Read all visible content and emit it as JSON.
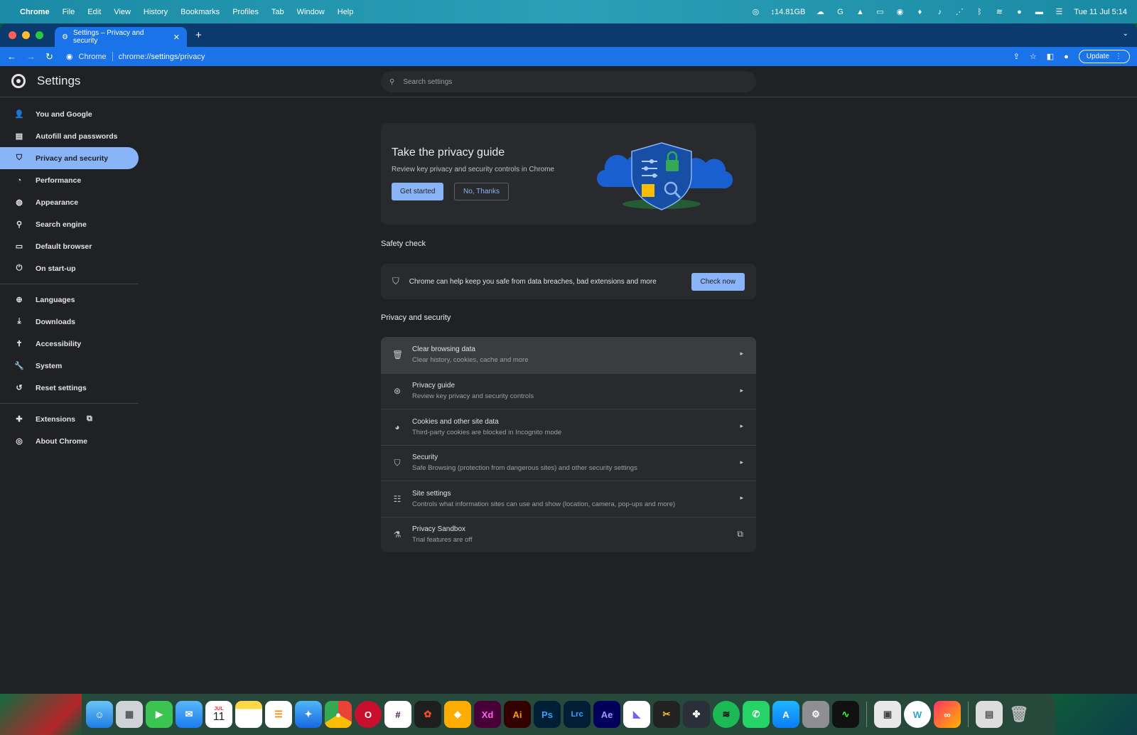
{
  "menubar": {
    "app": "Chrome",
    "items": [
      "File",
      "Edit",
      "View",
      "History",
      "Bookmarks",
      "Profiles",
      "Tab",
      "Window",
      "Help"
    ],
    "memory": "14.81GB",
    "datetime": "Tue 11 Jul  5:14"
  },
  "browser": {
    "tab_title": "Settings – Privacy and security",
    "omnibox_site": "Chrome",
    "url_prefix": "chrome://",
    "url_bold": "settings",
    "url_suffix": "/privacy",
    "update_label": "Update"
  },
  "settings": {
    "title": "Settings",
    "search_placeholder": "Search settings"
  },
  "sidebar": {
    "group1": [
      {
        "label": "You and Google",
        "icon": "person-icon"
      },
      {
        "label": "Autofill and passwords",
        "icon": "clipboard-icon"
      },
      {
        "label": "Privacy and security",
        "icon": "shield-icon",
        "active": true
      },
      {
        "label": "Performance",
        "icon": "speedometer-icon"
      },
      {
        "label": "Appearance",
        "icon": "palette-icon"
      },
      {
        "label": "Search engine",
        "icon": "search-icon"
      },
      {
        "label": "Default browser",
        "icon": "browser-icon"
      },
      {
        "label": "On start-up",
        "icon": "power-icon"
      }
    ],
    "group2": [
      {
        "label": "Languages",
        "icon": "globe-icon"
      },
      {
        "label": "Downloads",
        "icon": "download-icon"
      },
      {
        "label": "Accessibility",
        "icon": "accessibility-icon"
      },
      {
        "label": "System",
        "icon": "wrench-icon"
      },
      {
        "label": "Reset settings",
        "icon": "history-icon"
      }
    ],
    "group3": [
      {
        "label": "Extensions",
        "icon": "puzzle-icon"
      },
      {
        "label": "About Chrome",
        "icon": "chrome-icon"
      }
    ]
  },
  "guide": {
    "title": "Take the privacy guide",
    "subtitle": "Review key privacy and security controls in Chrome",
    "primary": "Get started",
    "secondary": "No, Thanks"
  },
  "safety": {
    "label": "Safety check",
    "text": "Chrome can help keep you safe from data breaches, bad extensions and more",
    "button": "Check now"
  },
  "privacy": {
    "label": "Privacy and security",
    "rows": [
      {
        "title": "Clear browsing data",
        "sub": "Clear history, cookies, cache and more",
        "icon": "trash-icon"
      },
      {
        "title": "Privacy guide",
        "sub": "Review key privacy and security controls",
        "icon": "compass-icon"
      },
      {
        "title": "Cookies and other site data",
        "sub": "Third-party cookies are blocked in Incognito mode",
        "icon": "cookie-icon"
      },
      {
        "title": "Security",
        "sub": "Safe Browsing (protection from dangerous sites) and other security settings",
        "icon": "shield-icon"
      },
      {
        "title": "Site settings",
        "sub": "Controls what information sites can use and show (location, camera, pop-ups and more)",
        "icon": "sliders-icon"
      },
      {
        "title": "Privacy Sandbox",
        "sub": "Trial features are off",
        "icon": "flask-icon",
        "external": true
      }
    ]
  },
  "dock": {
    "calendar_month": "JUL",
    "calendar_day": "11",
    "labels": [
      "Xd",
      "Ai",
      "Ps",
      "Lrc",
      "Ae"
    ]
  }
}
